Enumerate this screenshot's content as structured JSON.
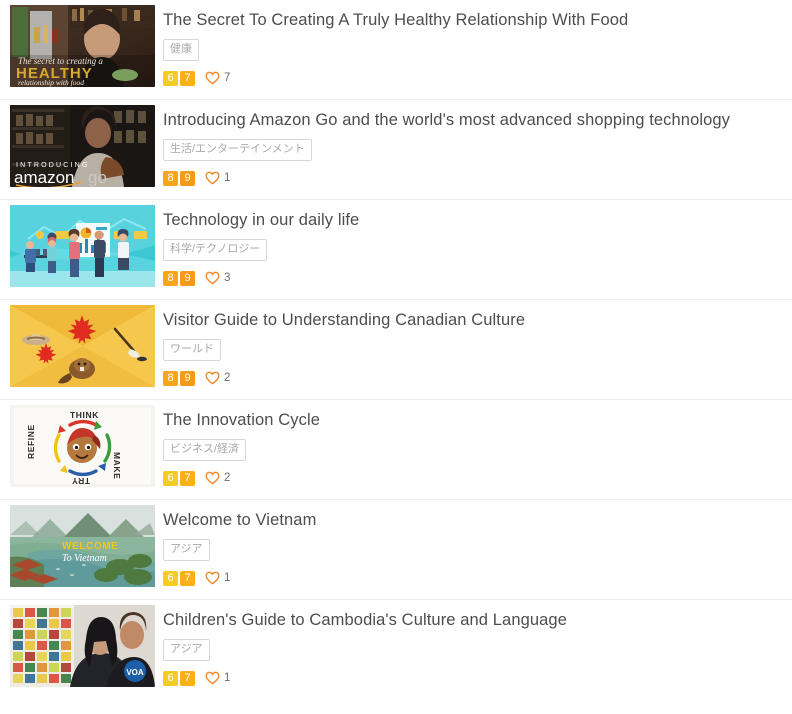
{
  "list": {
    "items": [
      {
        "title": "The Secret To Creating A Truly Healthy Relationship With Food",
        "tag": "健康",
        "score_left": "6",
        "score_right": "7",
        "likes": "7",
        "thumbnail_name": "healthy-relationship-with-food-thumbnail",
        "thumbnail_alt": "Woman in a kitchen with text overlay The secret to creating a HEALTHY relationship with food"
      },
      {
        "title": "Introducing Amazon Go and the world's most advanced shopping technology",
        "tag": "生活/エンターテインメント",
        "score_left": "8",
        "score_right": "9",
        "likes": "1",
        "thumbnail_name": "amazon-go-thumbnail",
        "thumbnail_alt": "Woman shopping in a dark grocery aisle with INTRODUCING amazon go logo"
      },
      {
        "title": "Technology in our daily life",
        "tag": "科学/テクノロジー",
        "score_left": "8",
        "score_right": "9",
        "likes": "3",
        "thumbnail_name": "technology-daily-life-thumbnail",
        "thumbnail_alt": "Flat illustration of people with laptops and charts on a teal background"
      },
      {
        "title": "Visitor Guide to Understanding Canadian Culture",
        "tag": "ワールド",
        "score_left": "8",
        "score_right": "9",
        "likes": "2",
        "thumbnail_name": "canadian-culture-thumbnail",
        "thumbnail_alt": "Yellow graphic with maple leaves, mountie hat, beaver and hockey stick"
      },
      {
        "title": "The Innovation Cycle",
        "tag": "ビジネス/経済",
        "score_left": "6",
        "score_right": "7",
        "likes": "2",
        "thumbnail_name": "innovation-cycle-thumbnail",
        "thumbnail_alt": "Circular arrows labeled THINK MAKE TRY REFINE around a cartoon face"
      },
      {
        "title": "Welcome to Vietnam",
        "tag": "アジア",
        "score_left": "6",
        "score_right": "7",
        "likes": "1",
        "thumbnail_name": "welcome-to-vietnam-thumbnail",
        "thumbnail_alt": "River winding between green karst mountains with WELCOME To Vietnam text"
      },
      {
        "title": "Children's Guide to Cambodia's Culture and Language",
        "tag": "アジア",
        "score_left": "6",
        "score_right": "7",
        "likes": "1",
        "thumbnail_name": "cambodia-culture-thumbnail",
        "thumbnail_alt": "Woman and boy pointing at a colorful alphabet chart with VOA logo"
      }
    ]
  },
  "icons": {
    "heart": "heart-outline-icon"
  },
  "colors": {
    "score_low": "#f5cb24",
    "score_high": "#f9a51a",
    "heart": "#f08a2b",
    "title_text": "#4d4d4d",
    "tag_text": "#a9a9a9",
    "divider": "#ededed"
  },
  "thumbnail_art": {
    "healthy": {
      "headline": "HEALTHY",
      "script_top": "The secret to creating a",
      "script_bottom": "relationship with food"
    },
    "amazon": {
      "kicker": "INTRODUCING",
      "wordmark": "amazon",
      "suffix": "go"
    },
    "innovation": {
      "think": "THINK",
      "make": "MAKE",
      "try": "TRY",
      "refine": "REFINE"
    },
    "vietnam": {
      "line1": "WELCOME",
      "line2": "To Vietnam"
    },
    "cambodia": {
      "logo": "VOA"
    }
  }
}
